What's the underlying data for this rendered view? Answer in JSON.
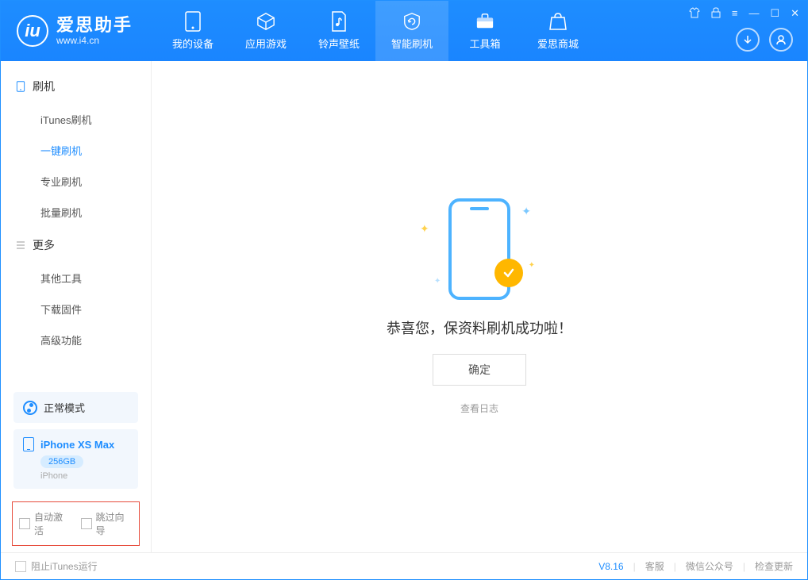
{
  "app": {
    "title": "爱思助手",
    "subtitle": "www.i4.cn"
  },
  "nav": {
    "items": [
      {
        "label": "我的设备"
      },
      {
        "label": "应用游戏"
      },
      {
        "label": "铃声壁纸"
      },
      {
        "label": "智能刷机"
      },
      {
        "label": "工具箱"
      },
      {
        "label": "爱思商城"
      }
    ]
  },
  "sidebar": {
    "flash_header": "刷机",
    "flash_items": [
      {
        "label": "iTunes刷机"
      },
      {
        "label": "一键刷机"
      },
      {
        "label": "专业刷机"
      },
      {
        "label": "批量刷机"
      }
    ],
    "more_header": "更多",
    "more_items": [
      {
        "label": "其他工具"
      },
      {
        "label": "下载固件"
      },
      {
        "label": "高级功能"
      }
    ],
    "mode_label": "正常模式",
    "device": {
      "name": "iPhone XS Max",
      "storage": "256GB",
      "type": "iPhone"
    },
    "auto_activate": "自动激活",
    "skip_wizard": "跳过向导"
  },
  "main": {
    "success_msg": "恭喜您，保资料刷机成功啦！",
    "ok": "确定",
    "view_log": "查看日志"
  },
  "footer": {
    "block_itunes": "阻止iTunes运行",
    "version": "V8.16",
    "support": "客服",
    "wechat": "微信公众号",
    "update": "检查更新"
  }
}
